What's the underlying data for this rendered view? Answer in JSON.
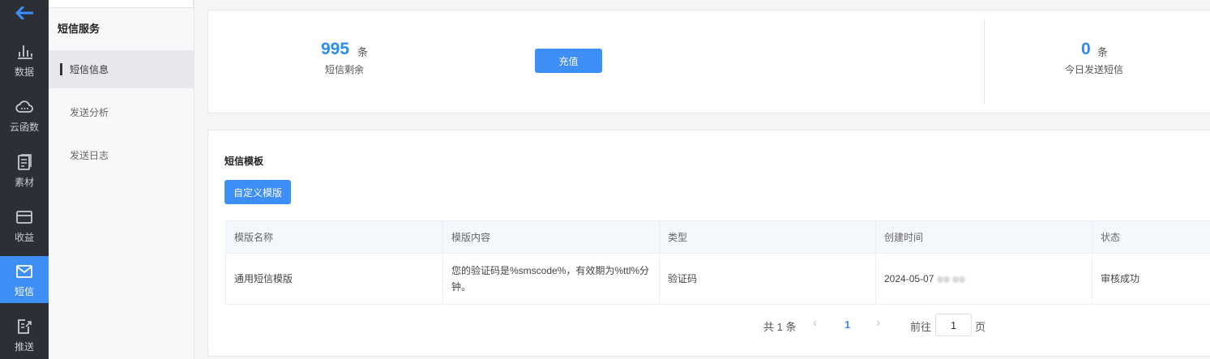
{
  "rail": {
    "items": [
      {
        "label": "数据",
        "icon": "chart-icon"
      },
      {
        "label": "云函数",
        "icon": "cloud-icon"
      },
      {
        "label": "素材",
        "icon": "document-icon"
      },
      {
        "label": "收益",
        "icon": "card-icon"
      },
      {
        "label": "短信",
        "icon": "mail-icon",
        "active": true
      },
      {
        "label": "推送",
        "icon": "push-icon"
      }
    ]
  },
  "submenu": {
    "title": "短信服务",
    "items": [
      {
        "label": "短信信息",
        "active": true
      },
      {
        "label": "发送分析"
      },
      {
        "label": "发送日志"
      }
    ]
  },
  "stats": {
    "remaining": {
      "value": "995",
      "unit": "条",
      "label": "短信剩余"
    },
    "recharge_label": "充值",
    "today": {
      "value": "0",
      "unit": "条",
      "label": "今日发送短信"
    }
  },
  "templates": {
    "heading": "短信模板",
    "custom_button": "自定义模版",
    "columns": [
      "模版名称",
      "模版内容",
      "类型",
      "创建时间",
      "状态"
    ],
    "rows": [
      {
        "name": "通用短信模版",
        "content": "您的验证码是%smscode%，有效期为%ttl%分钟。",
        "type": "验证码",
        "created": "2024-05-07",
        "status": "审核成功"
      }
    ]
  },
  "pagination": {
    "total_text": "共 1 条",
    "current_page": "1",
    "goto_label": "前往",
    "goto_value": "1",
    "page_suffix": "页"
  },
  "colors": {
    "accent": "#3d8ef5",
    "rail_bg": "#2c2f36",
    "number": "#2d8cf0"
  }
}
